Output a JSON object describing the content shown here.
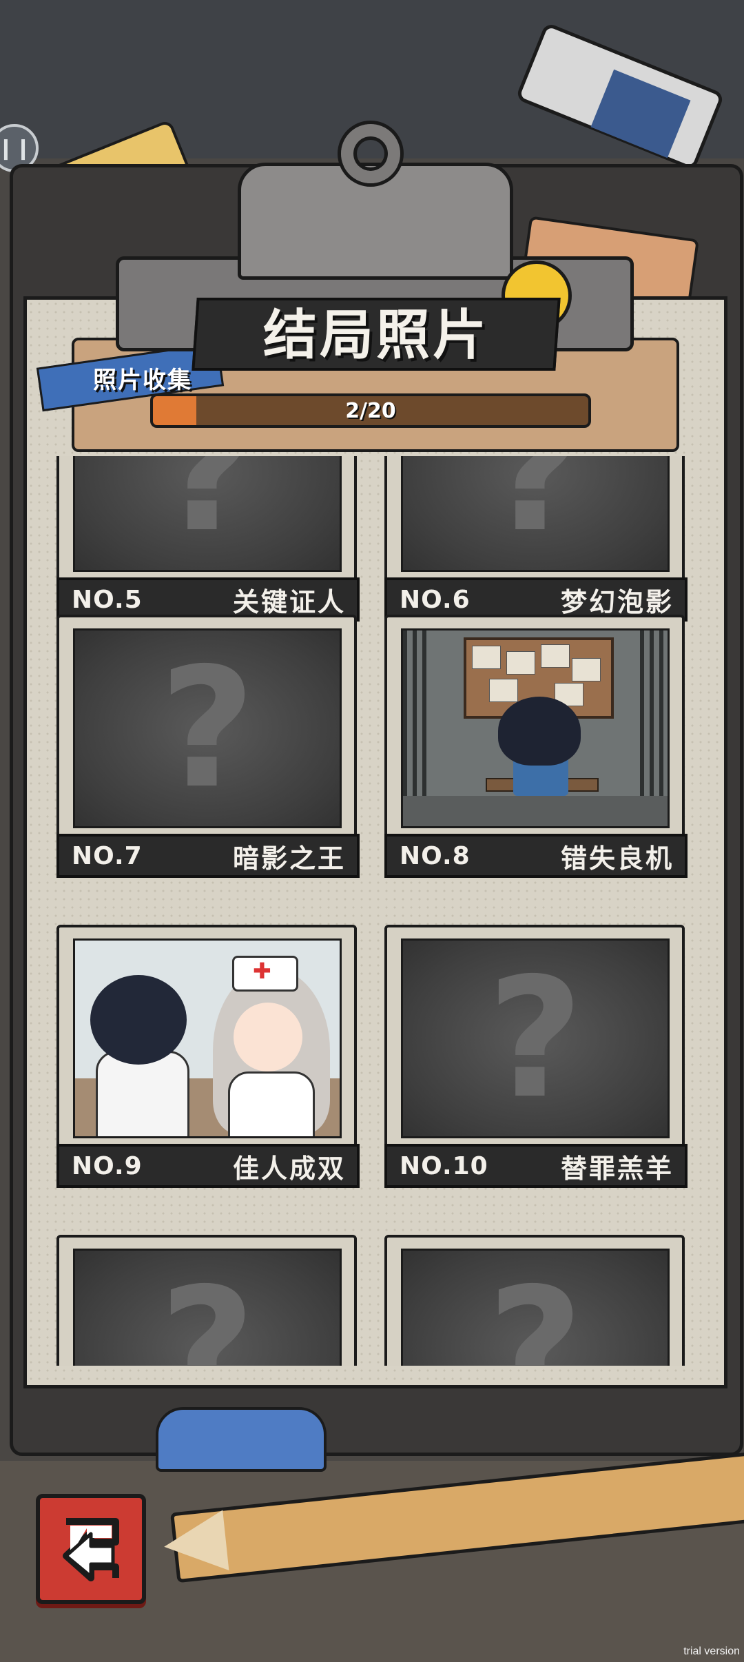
{
  "header": {
    "title": "结局照片"
  },
  "collection": {
    "label": "照片收集",
    "progress_text": "2/20",
    "collected": 2,
    "total": 20,
    "fill_color": "#e07a35"
  },
  "cards": [
    {
      "num": "NO.5",
      "name": "关键证人",
      "locked": true
    },
    {
      "num": "NO.6",
      "name": "梦幻泡影",
      "locked": true
    },
    {
      "num": "NO.7",
      "name": "暗影之王",
      "locked": true
    },
    {
      "num": "NO.8",
      "name": "错失良机",
      "locked": false
    },
    {
      "num": "NO.9",
      "name": "佳人成双",
      "locked": false
    },
    {
      "num": "NO.10",
      "name": "替罪羔羊",
      "locked": true
    }
  ],
  "locked_glyph": "?",
  "nurse_cap_glyph": "✚",
  "icons": {
    "exit": "exit-arrow-icon",
    "pin": "pin-icon"
  },
  "back_pin_glyph": "❙❙",
  "watermark": "trial version",
  "colors": {
    "exit_button": "#cc3b32",
    "paper": "#d8d3c6",
    "caption_bg": "#2a2a2a"
  }
}
